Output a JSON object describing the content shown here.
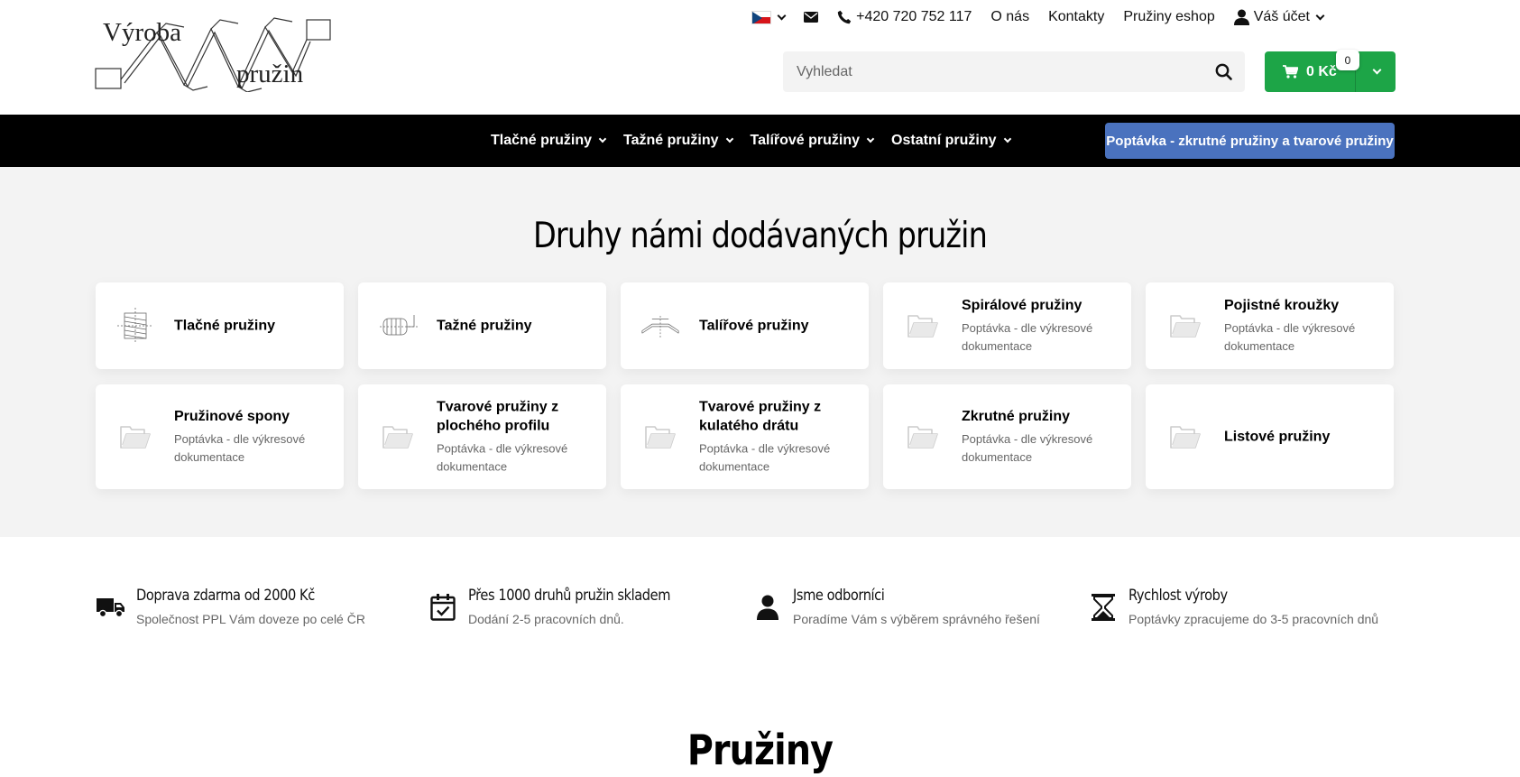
{
  "header": {
    "logo_line1": "Výroba",
    "logo_line2": "pružin",
    "topbar": {
      "language_flag": "czech-flag",
      "phone": "+420 720 752 117",
      "links": [
        "O nás",
        "Kontakty",
        "Pružiny eshop"
      ],
      "account_label": "Váš účet"
    },
    "search": {
      "placeholder": "Vyhledat"
    },
    "cart": {
      "total": "0 Kč",
      "count": "0",
      "color": "#1da547"
    }
  },
  "nav": {
    "items": [
      "Tlačné pružiny",
      "Tažné pružiny",
      "Talířové pružiny",
      "Ostatní pružiny"
    ],
    "cta_label": "Poptávka - zkrutné pružiny a tvarové pružiny",
    "cta_color": "#4a72be"
  },
  "categories": {
    "title": "Druhy námi dodávaných pružin",
    "cards": [
      {
        "name": "Tlačné pružiny",
        "desc": "",
        "icon": "compression-spring-drawing"
      },
      {
        "name": "Tažné pružiny",
        "desc": "",
        "icon": "extension-spring-drawing"
      },
      {
        "name": "Talířové pružiny",
        "desc": "",
        "icon": "disc-spring-drawing"
      },
      {
        "name": "Spirálové pružiny",
        "desc": "Poptávka - dle výkresové dokumentace",
        "icon": "folder-icon"
      },
      {
        "name": "Pojistné kroužky",
        "desc": "Poptávka - dle výkresové dokumentace",
        "icon": "folder-icon"
      },
      {
        "name": "Pružinové spony",
        "desc": "Poptávka - dle výkresové dokumentace",
        "icon": "folder-icon"
      },
      {
        "name": "Tvarové pružiny z plochého profilu",
        "desc": "Poptávka - dle výkresové dokumentace",
        "icon": "folder-icon"
      },
      {
        "name": "Tvarové pružiny z kulatého drátu",
        "desc": "Poptávka - dle výkresové dokumentace",
        "icon": "folder-icon"
      },
      {
        "name": "Zkrutné pružiny",
        "desc": "Poptávka - dle výkresové dokumentace",
        "icon": "folder-icon"
      },
      {
        "name": "Listové pružiny",
        "desc": "",
        "icon": "folder-icon"
      }
    ]
  },
  "benefits": [
    {
      "title": "Doprava zdarma od 2000 Kč",
      "desc": "Společnost PPL Vám doveze po celé ČR",
      "icon": "truck-icon"
    },
    {
      "title": "Přes 1000 druhů pružin skladem",
      "desc": "Dodání 2-5 pracovních dnů.",
      "icon": "calendar-check-icon"
    },
    {
      "title": "Jsme odborníci",
      "desc": "Poradíme Vám s výběrem správného řešení",
      "icon": "user-icon"
    },
    {
      "title": "Rychlost výroby",
      "desc": "Poptávky zpracujeme do 3-5 pracovních dnů",
      "icon": "hourglass-icon"
    }
  ],
  "section2": {
    "title": "Pružiny"
  }
}
